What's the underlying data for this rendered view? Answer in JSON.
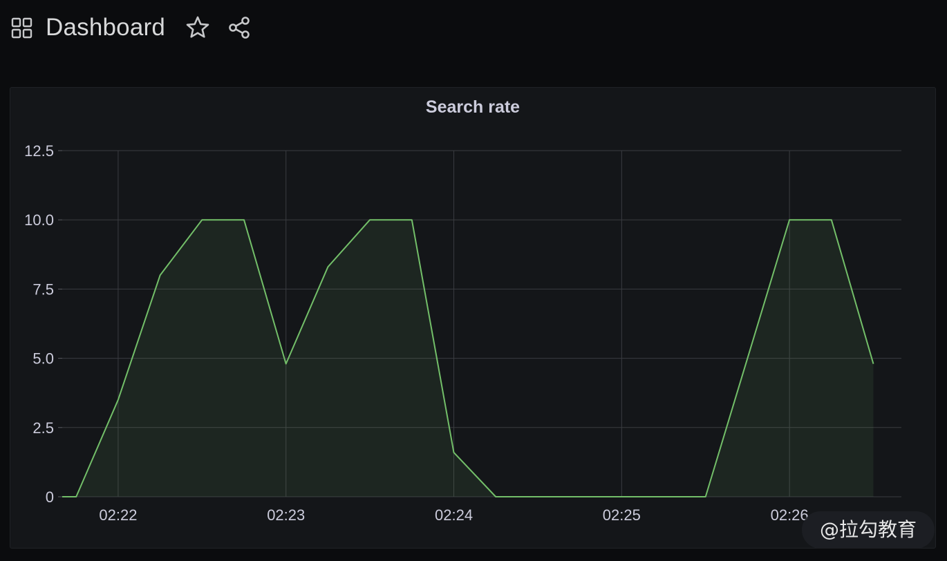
{
  "header": {
    "title": "Dashboard",
    "icons": {
      "grid": "grid-icon",
      "star": "star-icon",
      "share": "share-icon"
    }
  },
  "panel": {
    "title": "Search rate"
  },
  "chart_data": {
    "type": "area",
    "title": "Search rate",
    "xlabel": "",
    "ylabel": "",
    "x_tick_labels": [
      "02:22",
      "02:23",
      "02:24",
      "02:25",
      "02:26"
    ],
    "y_tick_labels": [
      "0",
      "2.5",
      "5.0",
      "7.5",
      "10.0",
      "12.5"
    ],
    "xlim": [
      "02:21:40",
      "02:26:40"
    ],
    "ylim": [
      0,
      12.5
    ],
    "grid": true,
    "series": [
      {
        "color": "#73bf69",
        "x": [
          "02:21:40",
          "02:21:45",
          "02:22:00",
          "02:22:15",
          "02:22:30",
          "02:22:45",
          "02:23:00",
          "02:23:15",
          "02:23:30",
          "02:23:45",
          "02:24:00",
          "02:24:15",
          "02:24:30",
          "02:24:45",
          "02:25:00",
          "02:25:15",
          "02:25:30",
          "02:25:45",
          "02:26:00",
          "02:26:15",
          "02:26:30"
        ],
        "values": [
          0,
          0,
          3.5,
          8.0,
          10.0,
          10.0,
          4.8,
          8.3,
          10.0,
          10.0,
          1.6,
          0,
          0,
          0,
          0,
          0,
          0,
          5.0,
          10.0,
          10.0,
          4.8
        ]
      }
    ]
  },
  "watermark": {
    "text": "@拉勾教育"
  }
}
